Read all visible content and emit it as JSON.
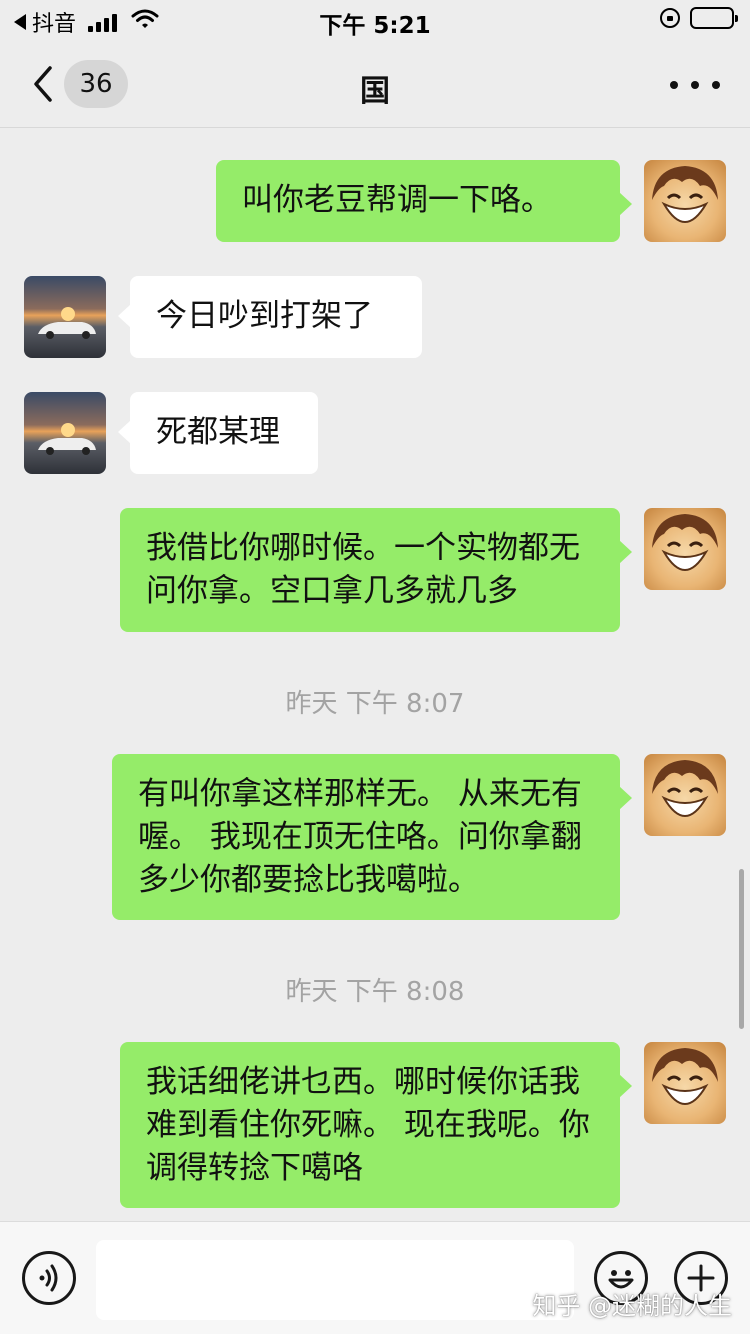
{
  "status_bar": {
    "back_app_label": "抖音",
    "time": "下午 5:21",
    "icons": [
      "back-triangle-icon",
      "signal-icon",
      "wifi-icon",
      "rotation-lock-icon",
      "battery-icon"
    ]
  },
  "nav": {
    "unread_count": "36",
    "title": "国",
    "icons": [
      "chevron-left-icon",
      "more-dots-icon"
    ]
  },
  "messages": [
    {
      "sender": "me",
      "text": "叫你老豆帮调一下咯。"
    },
    {
      "sender": "other",
      "text": "今日吵到打架了"
    },
    {
      "sender": "other",
      "text": "死都某理"
    },
    {
      "sender": "me",
      "text": "我借比你哪时候。一个实物都无问你拿。空口拿几多就几多"
    },
    {
      "type": "timestamp",
      "text": "昨天 下午 8:07"
    },
    {
      "sender": "me",
      "text": "有叫你拿这样那样无。 从来无有喔。 我现在顶无住咯。问你拿翻多少你都要捻比我噶啦。"
    },
    {
      "type": "timestamp",
      "text": "昨天 下午 8:08"
    },
    {
      "sender": "me",
      "text": "我话细佬讲乜西。哪时候你话我难到看住你死嘛。 现在我呢。你调得转捻下噶咯"
    }
  ],
  "input_bar": {
    "placeholder": "",
    "icons": [
      "voice-icon",
      "emoji-icon",
      "plus-icon"
    ]
  },
  "watermark": "知乎 @迷糊的人生",
  "colors": {
    "background": "#ededed",
    "my_bubble": "#95ec69",
    "other_bubble": "#ffffff",
    "timestamp_text": "#a3a3a3"
  }
}
